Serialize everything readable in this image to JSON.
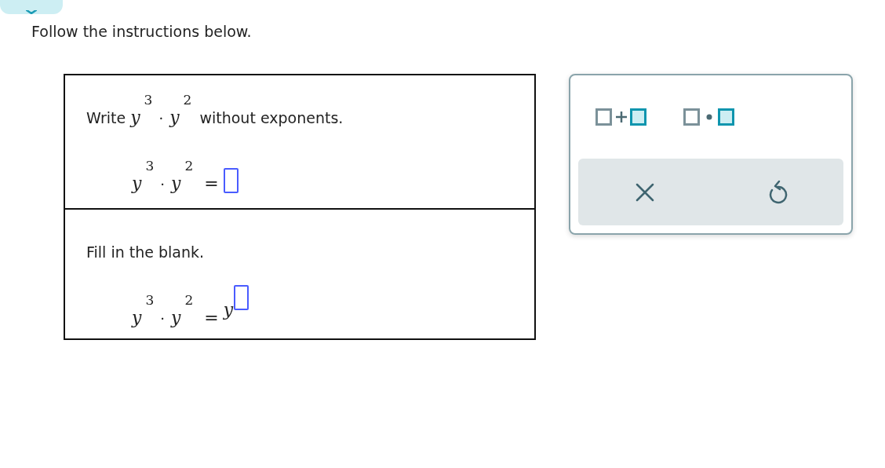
{
  "instruction": "Follow the instructions below.",
  "parts": [
    {
      "prompt_before": "Write",
      "prompt_math": [
        {
          "kind": "power",
          "base": "y",
          "exp": "3"
        },
        {
          "kind": "op",
          "text": "·"
        },
        {
          "kind": "power",
          "base": "y",
          "exp": "2"
        }
      ],
      "prompt_after": "without exponents.",
      "equation": {
        "lhs": [
          {
            "kind": "power",
            "base": "y",
            "exp": "3"
          },
          {
            "kind": "op",
            "text": "·"
          },
          {
            "kind": "power",
            "base": "y",
            "exp": "2"
          }
        ],
        "relation": "=",
        "rhs": {
          "kind": "blank"
        }
      }
    },
    {
      "prompt_before": "Fill in the blank.",
      "equation": {
        "lhs": [
          {
            "kind": "power",
            "base": "y",
            "exp": "3"
          },
          {
            "kind": "op",
            "text": "·"
          },
          {
            "kind": "power",
            "base": "y",
            "exp": "2"
          }
        ],
        "relation": "=",
        "rhs": {
          "kind": "power_blank",
          "base": "y"
        }
      }
    }
  ],
  "palette": {
    "templates": [
      {
        "kind": "sum"
      },
      {
        "kind": "product"
      }
    ],
    "actions": [
      {
        "kind": "clear"
      },
      {
        "kind": "undo"
      }
    ]
  }
}
